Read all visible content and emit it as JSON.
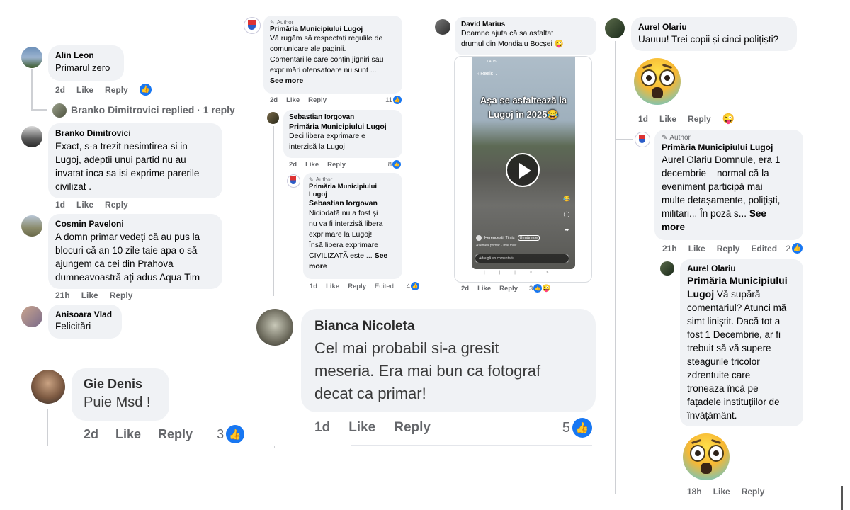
{
  "col1": {
    "c1": {
      "name": "Alin Leon",
      "text": "Primarul zero",
      "time": "2d",
      "like": "Like",
      "reply": "Reply"
    },
    "replies_link": "Branko Dimitrovici replied · 1 reply",
    "c2": {
      "name": "Branko Dimitrovici",
      "lines": [
        "Exact, s-a trezit nesimtirea si in",
        "Lugoj, adeptii unui partid nu au",
        "invatat inca sa isi exprime parerile",
        "civilizat ."
      ],
      "time": "1d",
      "like": "Like",
      "reply": "Reply"
    },
    "c3": {
      "name": "Cosmin Paveloni",
      "lines": [
        "A domn primar vedeți că au pus la",
        "blocuri că an 10 zile taie apa o să",
        "ajungem ca cei din Prahova",
        "dumneavoastră ați adus Aqua Tim"
      ],
      "time": "21h",
      "like": "Like",
      "reply": "Reply"
    },
    "c4": {
      "name": "Anisoara Vlad",
      "text": "Felicitări"
    },
    "c5": {
      "name": "Gie Denis",
      "text": "Puie Msd !",
      "time": "2d",
      "like": "Like",
      "reply": "Reply",
      "count": "3"
    }
  },
  "col2": {
    "c1": {
      "tag": "Author",
      "name": "Primăria Municipiului Lugoj",
      "lines": [
        "Vă rugăm să respectați regulile de",
        "comunicare ale paginii.",
        "Comentariile care conțin jigniri sau",
        "exprimări ofensatoare nu sunt ..."
      ],
      "see_more": "See more",
      "time": "2d",
      "like": "Like",
      "reply": "Reply",
      "count": "11"
    },
    "c2": {
      "name": "Sebastian Iorgovan",
      "mention": "Primăria Municipiului Lugoj",
      "lines": [
        "Deci libera exprimare e",
        "interzisă la Lugoj"
      ],
      "time": "2d",
      "like": "Like",
      "reply": "Reply",
      "count": "8"
    },
    "c3": {
      "tag": "Author",
      "name1": "Primăria Municipiului",
      "name2": "Lugoj",
      "mention": "Sebastian Iorgovan",
      "lines": [
        "Niciodată nu a fost și",
        "nu va fi interzisă libera",
        "exprimare la Lugoj!",
        "Însă libera exprimare"
      ],
      "last": "CIVILIZATĂ este ...",
      "see": "See",
      "more": "more",
      "time": "1d",
      "like": "Like",
      "reply": "Reply",
      "edited": "Edited",
      "count": "4"
    },
    "c4": {
      "name": "Bianca Nicoleta",
      "lines": [
        "Cel mai probabil si-a gresit",
        "meseria. Era mai bun ca fotograf",
        "decat ca primar!"
      ],
      "time": "1d",
      "like": "Like",
      "reply": "Reply",
      "count": "5"
    }
  },
  "col3": {
    "c1": {
      "name": "David Marius",
      "lines": [
        "Doamne ajuta că sa asfaltat",
        "drumul din Mondialu Bocșei 😜"
      ],
      "time": "2d",
      "like": "Like",
      "reply": "Reply",
      "count": "3"
    },
    "video": {
      "status_time": "04:15",
      "back": "Reels",
      "overlay1": "Așa se asfaltează la",
      "overlay2": "Lugoj în 2025😂",
      "location": "Herendești, Timiș",
      "follow": "Urmărește",
      "caption": "Asemea primar · mai mult",
      "comment_placeholder": "Adaugă un comentariu..."
    }
  },
  "col4": {
    "c1": {
      "name": "Aurel Olariu",
      "text": "Uauuu! Trei copii și cinci polițiști?",
      "time": "1d",
      "like": "Like",
      "reply": "Reply"
    },
    "c2": {
      "tag": "Author",
      "name": "Primăria Municipiului Lugoj",
      "lines": [
        "Aurel Olariu Domnule, era 1",
        "decembrie – normal că la",
        "eveniment participă mai",
        "multe detașamente, polițiști,"
      ],
      "last": "militari... În poză s...",
      "see": "See",
      "more": "more",
      "time": "21h",
      "like": "Like",
      "reply": "Reply",
      "edited": "Edited",
      "count": "2"
    },
    "c3": {
      "name": "Aurel Olariu",
      "mention1": "Primăria Municipiului",
      "mention2": "Lugoj",
      "mention_tail": " Vă supără",
      "lines": [
        "comentariul? Atunci mă",
        "simt liniștit. Dacă tot a",
        "fost 1 Decembrie, ar fi",
        "trebuit să vă supere",
        "steagurile tricolor",
        "zdrentuite care",
        "troneaza încă pe",
        "fațadele instituțiilor de",
        "învățământ."
      ],
      "time": "18h",
      "like": "Like",
      "reply": "Reply"
    }
  },
  "colors": {
    "bubble": "#f0f2f5",
    "meta": "#65676b",
    "like_blue": "#1877f2",
    "thread_line": "#ced0d4"
  }
}
